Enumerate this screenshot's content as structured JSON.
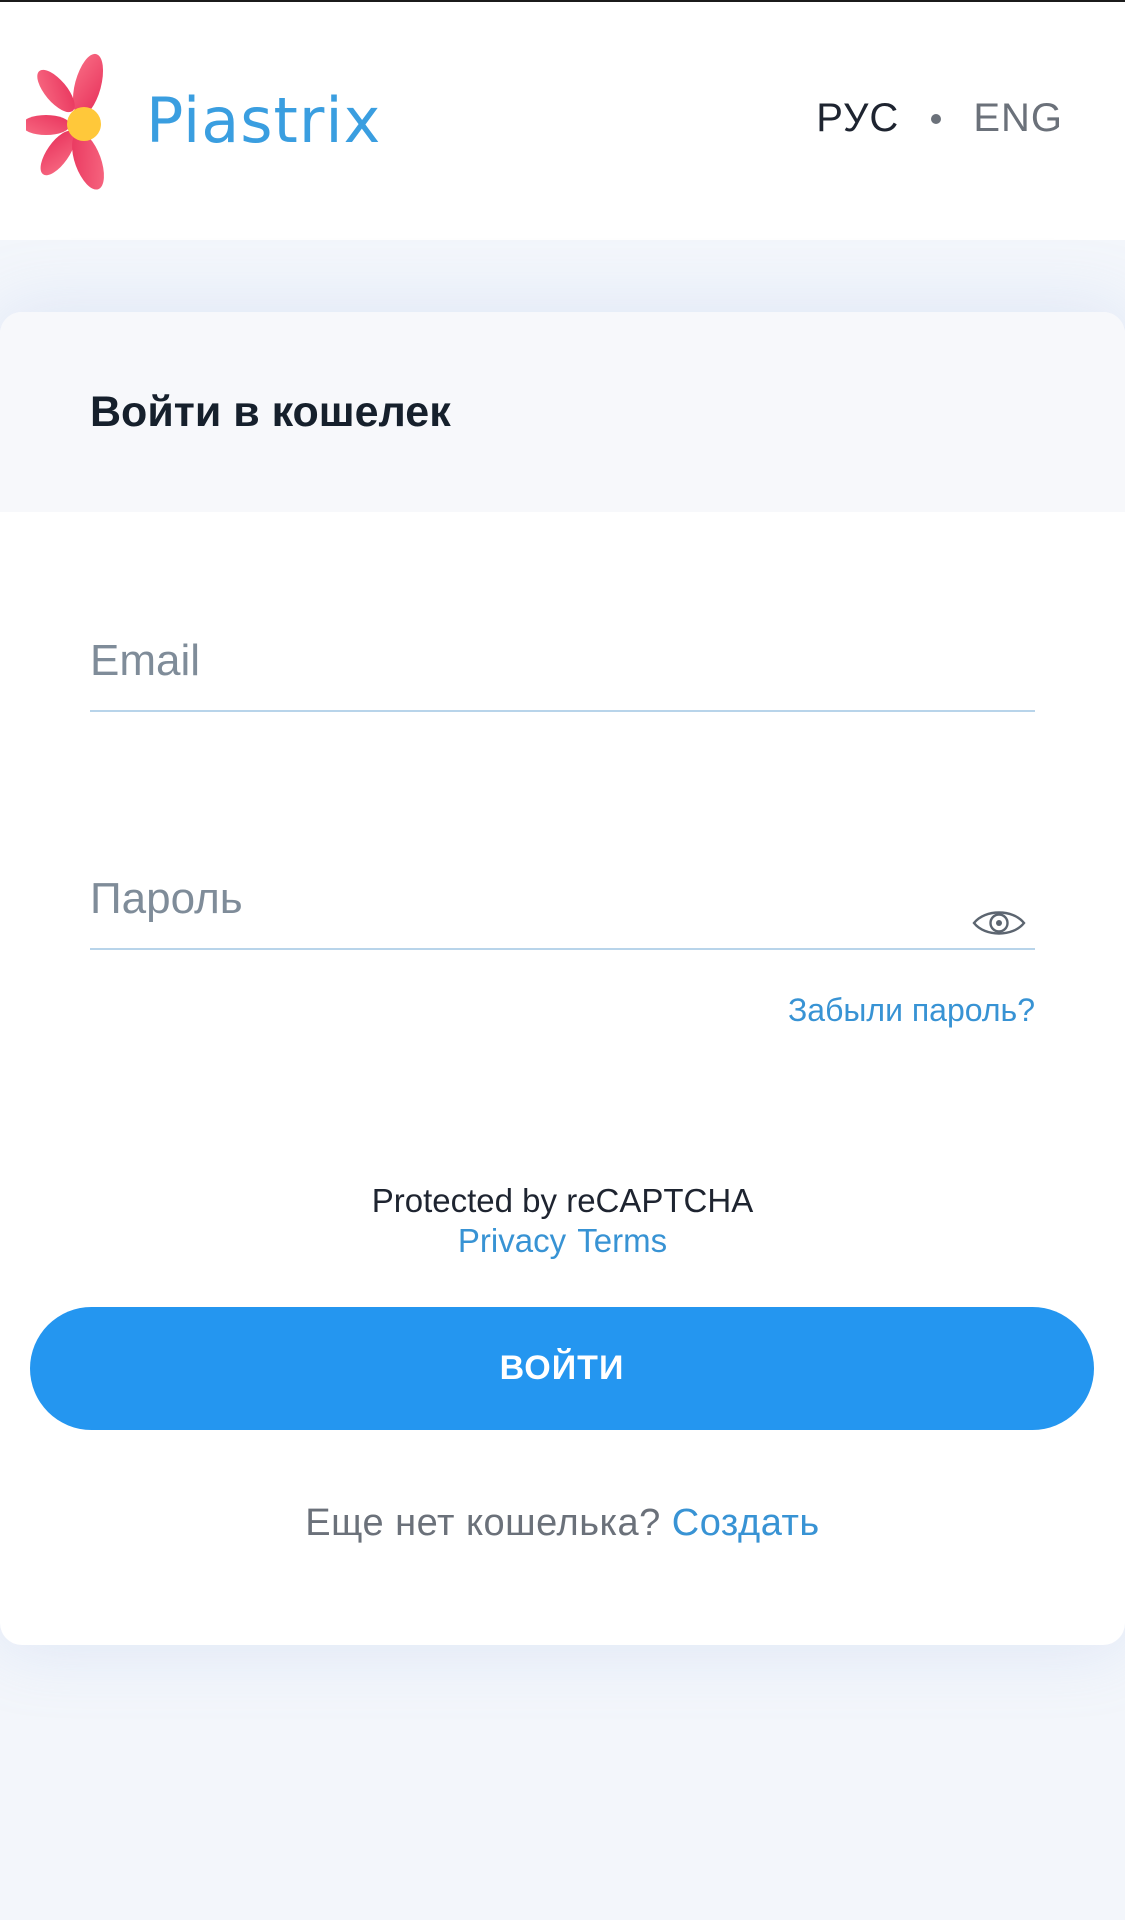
{
  "header": {
    "brand": "Piastrix",
    "lang_ru": "РУС",
    "lang_en": "ENG"
  },
  "card": {
    "title": "Войти в кошелек",
    "email_placeholder": "Email",
    "password_placeholder": "Пароль",
    "forgot_password": "Забыли пароль?",
    "recaptcha_text": "Protected by reCAPTCHA",
    "privacy_link": "Privacy",
    "terms_link": "Terms",
    "login_button": "ВОЙТИ",
    "signup_prompt": "Еще нет кошелька?",
    "signup_link": "Создать"
  },
  "icons": {
    "logo": "flower-logo-icon",
    "show_password": "eye-icon"
  },
  "colors": {
    "brand": "#3a9ee0",
    "accent": "#2496f0",
    "link": "#3893d4",
    "logo_petals": "#f5506e",
    "logo_center": "#ffc83a"
  }
}
